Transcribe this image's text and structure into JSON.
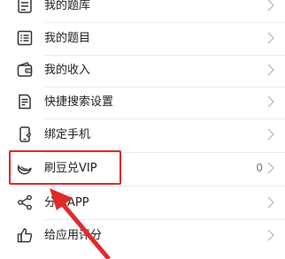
{
  "menu": {
    "items": [
      {
        "label": "我的题库",
        "icon": "question-bank-icon"
      },
      {
        "label": "我的题目",
        "icon": "question-list-icon"
      },
      {
        "label": "我的收入",
        "icon": "wallet-icon"
      },
      {
        "label": "快捷搜索设置",
        "icon": "search-settings-icon"
      },
      {
        "label": "绑定手机",
        "icon": "phone-icon"
      },
      {
        "label": "刷豆兑VIP",
        "icon": "bean-vip-icon",
        "count": "0"
      },
      {
        "label": "分享APP",
        "icon": "share-icon"
      },
      {
        "label": "给应用评分",
        "icon": "thumbs-up-icon"
      }
    ]
  },
  "annotation": {
    "highlight_color": "#e02a2a"
  }
}
